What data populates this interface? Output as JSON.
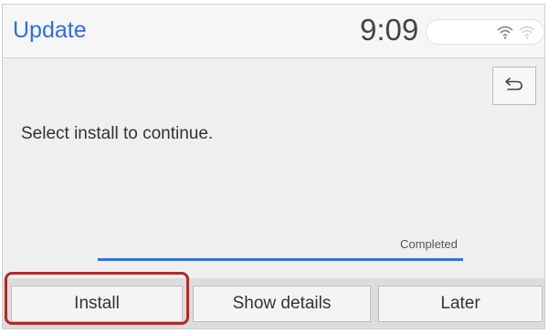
{
  "header": {
    "title": "Update",
    "time": "9:09",
    "status_icons": [
      "wifi-icon",
      "wifi-weak-icon"
    ]
  },
  "main": {
    "message": "Select install to continue.",
    "back_icon": "back-arrow-icon",
    "progress": {
      "label": "Completed",
      "value": 1.0
    }
  },
  "buttons": {
    "install": "Install",
    "show_details": "Show details",
    "later": "Later"
  },
  "colors": {
    "accent": "#2f6fd8",
    "progress": "#3472d9",
    "highlight": "#b02a2a"
  }
}
